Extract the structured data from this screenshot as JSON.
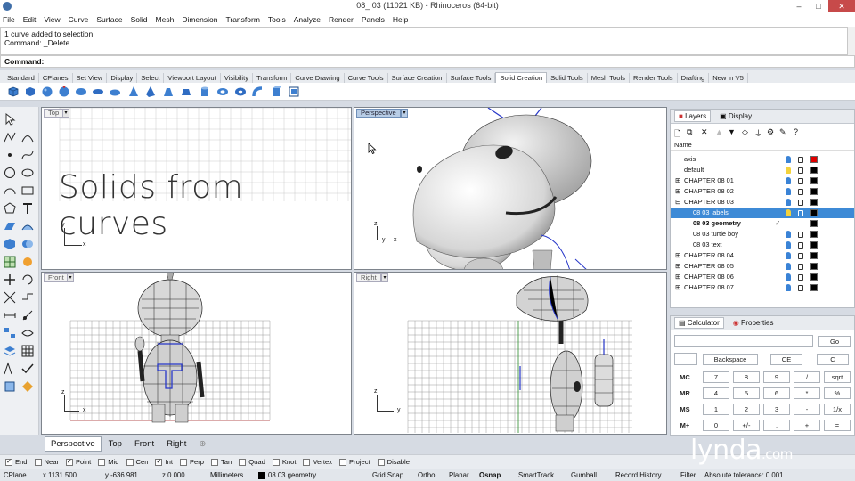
{
  "window": {
    "title": "08_ 03 (11021 KB) - Rhinoceros (64-bit)",
    "controls": [
      "–",
      "□",
      "✕"
    ]
  },
  "menu": [
    "File",
    "Edit",
    "View",
    "Curve",
    "Surface",
    "Solid",
    "Mesh",
    "Dimension",
    "Transform",
    "Tools",
    "Analyze",
    "Render",
    "Panels",
    "Help"
  ],
  "history": {
    "lines": [
      "1 curve added to selection.",
      "Command: _Delete"
    ]
  },
  "command": {
    "label": "Command:"
  },
  "toolbar_tabs": [
    {
      "label": "Standard"
    },
    {
      "label": "CPlanes"
    },
    {
      "label": "Set View"
    },
    {
      "label": "Display"
    },
    {
      "label": "Select"
    },
    {
      "label": "Viewport Layout"
    },
    {
      "label": "Visibility"
    },
    {
      "label": "Transform"
    },
    {
      "label": "Curve Drawing"
    },
    {
      "label": "Curve Tools"
    },
    {
      "label": "Surface Creation"
    },
    {
      "label": "Surface Tools"
    },
    {
      "label": "Solid Creation",
      "active": true
    },
    {
      "label": "Solid Tools"
    },
    {
      "label": "Mesh Tools"
    },
    {
      "label": "Render Tools"
    },
    {
      "label": "Drafting"
    },
    {
      "label": "New in V5"
    }
  ],
  "viewports": {
    "top": {
      "label": "Top",
      "overlay_text": "Solids from curves",
      "axes": {
        "y": "y",
        "x": "x"
      }
    },
    "perspective": {
      "label": "Perspective",
      "axes": {
        "z": "z",
        "y": "y",
        "x": "x"
      }
    },
    "front": {
      "label": "Front",
      "axes": {
        "z": "z",
        "x": "x"
      }
    },
    "right": {
      "label": "Right",
      "axes": {
        "z": "z",
        "y": "y"
      }
    }
  },
  "view_tabs": [
    {
      "label": "Perspective",
      "active": true
    },
    {
      "label": "Top"
    },
    {
      "label": "Front"
    },
    {
      "label": "Right"
    },
    {
      "label": "⊕"
    }
  ],
  "layers_panel": {
    "tabs": [
      {
        "label": "Layers",
        "active": true
      },
      {
        "label": "Display"
      }
    ],
    "column_header": "Name",
    "rows": [
      {
        "name": "axis",
        "expand": "",
        "color": "#e00000",
        "bold": false
      },
      {
        "name": "default",
        "expand": "",
        "color": "#000000",
        "bold": false
      },
      {
        "name": "CHAPTER 08 01",
        "expand": "⊞",
        "color": "#000000",
        "bold": false
      },
      {
        "name": "CHAPTER 08 02",
        "expand": "⊞",
        "color": "#000000",
        "bold": false
      },
      {
        "name": "CHAPTER 08 03",
        "expand": "⊟",
        "color": "#000000",
        "bold": false
      },
      {
        "name": "08 03 labels",
        "expand": "",
        "color": "#000000",
        "bold": false,
        "selected": true
      },
      {
        "name": "08 03 geometry",
        "expand": "",
        "color": "#000000",
        "bold": true,
        "current": "✓"
      },
      {
        "name": "08 03 turtle boy",
        "expand": "",
        "color": "#000000",
        "bold": false
      },
      {
        "name": "08 03 text",
        "expand": "",
        "color": "#000000",
        "bold": false
      },
      {
        "name": "CHAPTER 08 04",
        "expand": "⊞",
        "color": "#000000",
        "bold": false
      },
      {
        "name": "CHAPTER 08 05",
        "expand": "⊞",
        "color": "#000000",
        "bold": false
      },
      {
        "name": "CHAPTER 08 06",
        "expand": "⊞",
        "color": "#000000",
        "bold": false
      },
      {
        "name": "CHAPTER 08 07",
        "expand": "⊞",
        "color": "#000000",
        "bold": false
      }
    ]
  },
  "calculator": {
    "tabs": [
      {
        "label": "Calculator",
        "active": true
      },
      {
        "label": "Properties"
      }
    ],
    "go": "Go",
    "backspace": "Backspace",
    "ce": "CE",
    "c": "C",
    "rows": [
      [
        "MC",
        "7",
        "8",
        "9",
        "/",
        "sqrt"
      ],
      [
        "MR",
        "4",
        "5",
        "6",
        "*",
        "%"
      ],
      [
        "MS",
        "1",
        "2",
        "3",
        "-",
        "1/x"
      ],
      [
        "M+",
        "0",
        "+/-",
        ".",
        "+",
        "="
      ]
    ]
  },
  "osnap": [
    {
      "label": "End",
      "checked": true
    },
    {
      "label": "Near",
      "checked": false
    },
    {
      "label": "Point",
      "checked": true
    },
    {
      "label": "Mid",
      "checked": false
    },
    {
      "label": "Cen",
      "checked": false
    },
    {
      "label": "Int",
      "checked": true
    },
    {
      "label": "Perp",
      "checked": false
    },
    {
      "label": "Tan",
      "checked": false
    },
    {
      "label": "Quad",
      "checked": false
    },
    {
      "label": "Knot",
      "checked": false
    },
    {
      "label": "Vertex",
      "checked": false
    },
    {
      "label": "Project",
      "checked": false
    },
    {
      "label": "Disable",
      "checked": false
    }
  ],
  "status": {
    "cplane": "CPlane",
    "x": "x 1131.500",
    "y": "y -636.981",
    "z": "z 0.000",
    "units": "Millimeters",
    "layer": "08 03 geometry",
    "toggles": [
      "Grid Snap",
      "Ortho",
      "Planar",
      "Osnap",
      "SmartTrack",
      "Gumball",
      "Record History",
      "Filter"
    ],
    "active_toggle": "Osnap",
    "tolerance": "Absolute tolerance: 0.001"
  },
  "watermark": {
    "brand": "lynda",
    "suffix": ".com"
  }
}
